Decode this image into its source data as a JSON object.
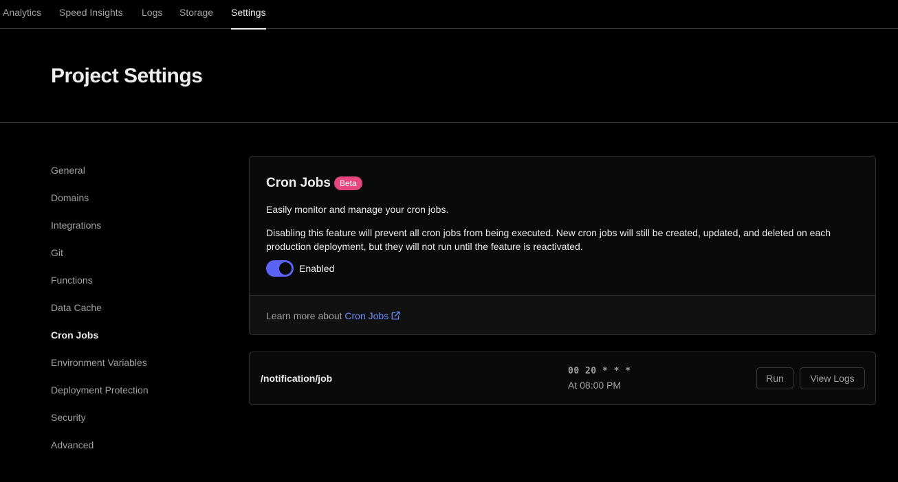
{
  "topnav": {
    "tabs": [
      {
        "label": "Analytics"
      },
      {
        "label": "Speed Insights"
      },
      {
        "label": "Logs"
      },
      {
        "label": "Storage"
      },
      {
        "label": "Settings",
        "active": true
      }
    ]
  },
  "header": {
    "title": "Project Settings"
  },
  "sidebar": {
    "items": [
      {
        "label": "General"
      },
      {
        "label": "Domains"
      },
      {
        "label": "Integrations"
      },
      {
        "label": "Git"
      },
      {
        "label": "Functions"
      },
      {
        "label": "Data Cache"
      },
      {
        "label": "Cron Jobs",
        "active": true
      },
      {
        "label": "Environment Variables"
      },
      {
        "label": "Deployment Protection"
      },
      {
        "label": "Security"
      },
      {
        "label": "Advanced"
      }
    ]
  },
  "cron_card": {
    "title": "Cron Jobs",
    "badge": "Beta",
    "description": "Easily monitor and manage your cron jobs.",
    "warning": "Disabling this feature will prevent all cron jobs from being executed. New cron jobs will still be created, updated, and deleted on each production deployment, but they will not run until the feature is reactivated.",
    "toggle_label": "Enabled",
    "toggle_on": true,
    "footer_prefix": "Learn more about ",
    "footer_link": "Cron Jobs"
  },
  "jobs": [
    {
      "path": "/notification/job",
      "schedule": "00 20 * * *",
      "schedule_human": "At 08:00 PM",
      "run_label": "Run",
      "logs_label": "View Logs"
    }
  ],
  "colors": {
    "background": "#000000",
    "accent": "#5b63f5",
    "badge": "#e5487f",
    "link": "#6e8dff"
  }
}
